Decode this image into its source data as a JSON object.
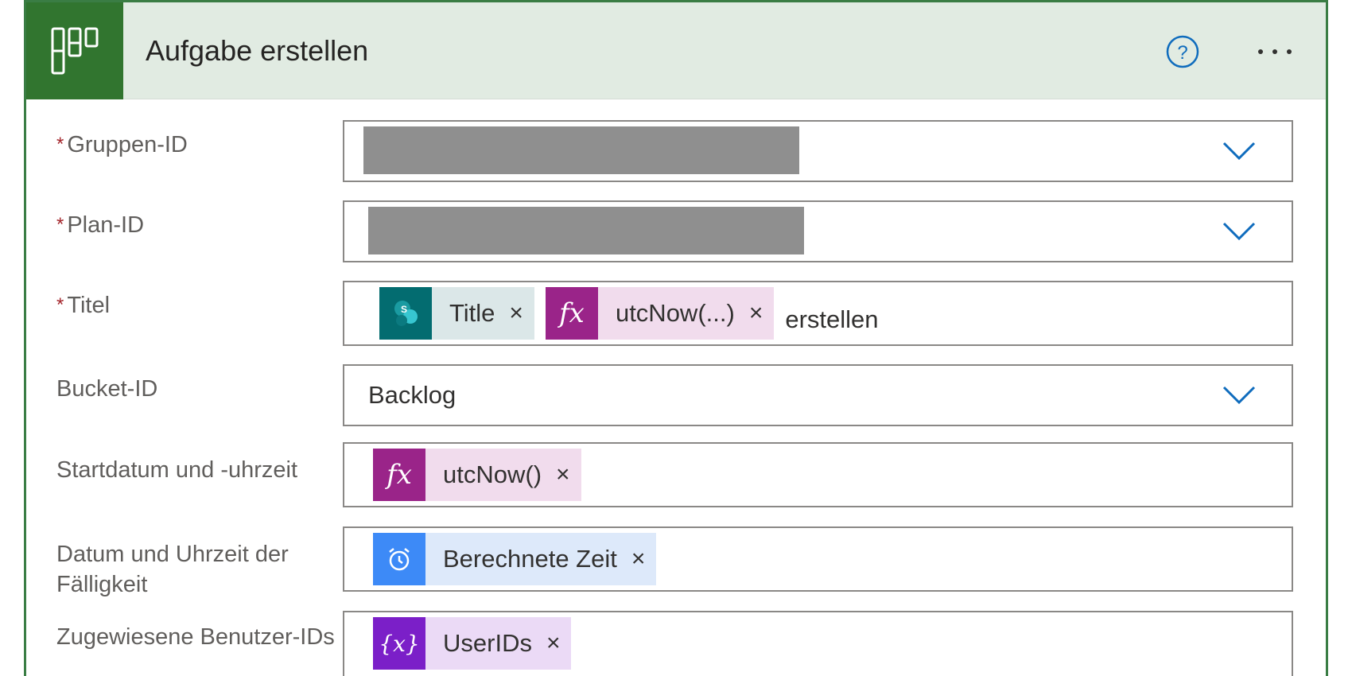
{
  "header": {
    "title": "Aufgabe erstellen",
    "icon": "planner-icon",
    "help_icon": "help-circle-icon",
    "more_icon": "more-horizontal-icon",
    "header_bg": "#e1ebe2",
    "icon_bg": "#31752f"
  },
  "fields": {
    "gruppen_id": {
      "label": "Gruppen-ID",
      "required": "*",
      "value": ""
    },
    "plan_id": {
      "label": "Plan-ID",
      "required": "*",
      "value": ""
    },
    "titel": {
      "label": "Titel",
      "required": "*",
      "tokens": [
        {
          "label": "Title",
          "close": "×",
          "icon": "sharepoint-icon",
          "icon_color": "#036c70",
          "bg": "#dbe7e8"
        },
        {
          "label": "utcNow(...)",
          "close": "×",
          "icon": "fx",
          "icon_color": "#9a2489",
          "bg": "#f1dced"
        }
      ],
      "suffix": "erstellen"
    },
    "bucket_id": {
      "label": "Bucket-ID",
      "value": "Backlog"
    },
    "startdatum": {
      "label": "Startdatum und -uhrzeit",
      "tokens": [
        {
          "label": "utcNow()",
          "close": "×",
          "icon": "fx",
          "icon_color": "#9a2489",
          "bg": "#f1dced"
        }
      ]
    },
    "faelligkeit": {
      "label": "Datum und Uhrzeit der Fälligkeit",
      "tokens": [
        {
          "label": "Berechnete Zeit",
          "close": "×",
          "icon": "alarm-clock-icon",
          "icon_color": "#3d8af7",
          "bg": "#dde9fa"
        }
      ]
    },
    "benutzer": {
      "label": "Zugewiesene Benutzer-IDs",
      "tokens": [
        {
          "label": "UserIDs",
          "close": "×",
          "icon": "variable",
          "icon_color": "#7b1fc8",
          "bg": "#ebdaf6"
        }
      ]
    }
  },
  "colors": {
    "border_green": "#3a7d44",
    "required_red": "#a4262c",
    "chevron_blue": "#0f6cbd"
  }
}
